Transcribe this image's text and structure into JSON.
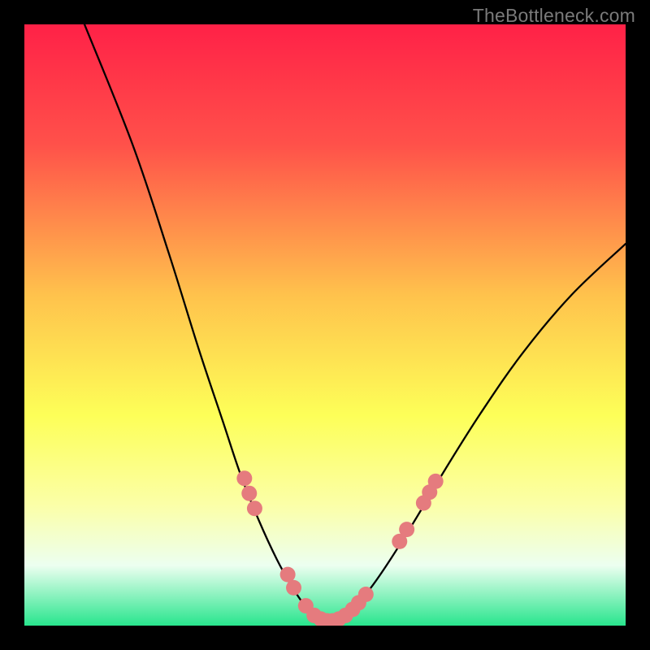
{
  "watermark": {
    "text": "TheBottleneck.com"
  },
  "chart_data": {
    "type": "line",
    "title": "",
    "xlabel": "",
    "ylabel": "",
    "xlim": [
      0,
      100
    ],
    "ylim": [
      0,
      100
    ],
    "gradient_stops": [
      {
        "offset": 0.0,
        "color": "#ff2147"
      },
      {
        "offset": 0.2,
        "color": "#ff514a"
      },
      {
        "offset": 0.45,
        "color": "#ffc24c"
      },
      {
        "offset": 0.65,
        "color": "#fdff58"
      },
      {
        "offset": 0.8,
        "color": "#fbffa8"
      },
      {
        "offset": 0.9,
        "color": "#ecfff0"
      },
      {
        "offset": 1.0,
        "color": "#28e58d"
      }
    ],
    "series": [
      {
        "name": "left-curve",
        "stroke": "#000000",
        "width": 2.3,
        "points": [
          {
            "x": 10.0,
            "y": 100.0
          },
          {
            "x": 18.0,
            "y": 80.0
          },
          {
            "x": 24.0,
            "y": 62.0
          },
          {
            "x": 29.0,
            "y": 46.0
          },
          {
            "x": 33.0,
            "y": 34.0
          },
          {
            "x": 36.0,
            "y": 25.0
          },
          {
            "x": 39.0,
            "y": 17.5
          },
          {
            "x": 42.0,
            "y": 11.0
          },
          {
            "x": 44.5,
            "y": 6.5
          },
          {
            "x": 46.5,
            "y": 3.5
          },
          {
            "x": 48.0,
            "y": 1.8
          },
          {
            "x": 49.5,
            "y": 0.9
          },
          {
            "x": 50.5,
            "y": 0.7
          }
        ]
      },
      {
        "name": "right-curve",
        "stroke": "#000000",
        "width": 2.3,
        "points": [
          {
            "x": 50.5,
            "y": 0.7
          },
          {
            "x": 52.0,
            "y": 0.9
          },
          {
            "x": 53.5,
            "y": 1.8
          },
          {
            "x": 55.5,
            "y": 3.7
          },
          {
            "x": 58.0,
            "y": 6.8
          },
          {
            "x": 61.0,
            "y": 11.2
          },
          {
            "x": 65.0,
            "y": 17.6
          },
          {
            "x": 70.0,
            "y": 26.0
          },
          {
            "x": 76.0,
            "y": 35.5
          },
          {
            "x": 83.0,
            "y": 45.5
          },
          {
            "x": 91.0,
            "y": 55.0
          },
          {
            "x": 100.0,
            "y": 63.5
          }
        ]
      }
    ],
    "markers": {
      "color": "#e57b7e",
      "radius": 9.5,
      "points": [
        {
          "x": 36.6,
          "y": 24.5
        },
        {
          "x": 37.4,
          "y": 22.0
        },
        {
          "x": 38.3,
          "y": 19.5
        },
        {
          "x": 43.8,
          "y": 8.5
        },
        {
          "x": 44.8,
          "y": 6.3
        },
        {
          "x": 46.8,
          "y": 3.3
        },
        {
          "x": 48.2,
          "y": 1.7
        },
        {
          "x": 49.3,
          "y": 1.1
        },
        {
          "x": 50.3,
          "y": 0.8
        },
        {
          "x": 51.3,
          "y": 0.8
        },
        {
          "x": 52.3,
          "y": 1.1
        },
        {
          "x": 53.4,
          "y": 1.7
        },
        {
          "x": 54.6,
          "y": 2.7
        },
        {
          "x": 55.6,
          "y": 3.8
        },
        {
          "x": 56.8,
          "y": 5.2
        },
        {
          "x": 62.4,
          "y": 14.0
        },
        {
          "x": 63.6,
          "y": 16.0
        },
        {
          "x": 66.4,
          "y": 20.4
        },
        {
          "x": 67.4,
          "y": 22.2
        },
        {
          "x": 68.4,
          "y": 24.0
        }
      ]
    }
  }
}
